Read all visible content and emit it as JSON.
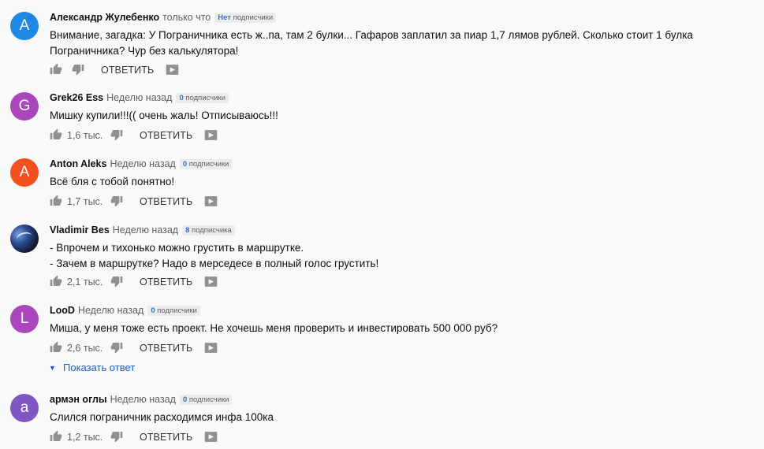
{
  "comments": [
    {
      "avatar_letter": "А",
      "avatar_color": "#1e88e5",
      "author": "Александр Жулебенко",
      "time": "только что",
      "badge_num": "Нет",
      "badge_label": "подписчики",
      "text": "Внимание, загадка: У Пограничника есть ж..па, там 2 булки... Гафаров заплатил за пиар 1,7 лямов рублей. Сколько стоит 1 булка Пограничника? Чур без калькулятора!",
      "likes": "",
      "reply_label": "ОТВЕТИТЬ"
    },
    {
      "avatar_letter": "G",
      "avatar_color": "#ab47bc",
      "author": "Grek26 Ess",
      "time": "Неделю назад",
      "badge_num": "0",
      "badge_label": "подписчики",
      "text": "Мишку купили!!!(( очень жаль! Отписываюсь!!!",
      "likes": "1,6 тыс.",
      "reply_label": "ОТВЕТИТЬ"
    },
    {
      "avatar_letter": "A",
      "avatar_color": "#f4511e",
      "author": "Anton Aleks",
      "time": "Неделю назад",
      "badge_num": "0",
      "badge_label": "подписчики",
      "text": "Всё бля с тобой понятно!",
      "likes": "1,7 тыс.",
      "reply_label": "ОТВЕТИТЬ"
    },
    {
      "avatar_letter": "",
      "avatar_color": "#1a2244",
      "author": "Vladimir Bes",
      "time": "Неделю назад",
      "badge_num": "8",
      "badge_label": "подписчика",
      "text_lines": [
        "- Впрочем и тихонько можно грустить в маршрутке.",
        "- Зачем в маршрутке? Надо в мерседесе в полный голос грустить!"
      ],
      "likes": "2,1 тыс.",
      "reply_label": "ОТВЕТИТЬ"
    },
    {
      "avatar_letter": "L",
      "avatar_color": "#ab47bc",
      "author": "LooD",
      "time": "Неделю назад",
      "badge_num": "0",
      "badge_label": "подписчики",
      "text": "Миша, у меня тоже есть проект. Не хочешь меня проверить и инвестировать 500 000 руб?",
      "likes": "2,6 тыс.",
      "reply_label": "ОТВЕТИТЬ",
      "show_replies": "Показать ответ"
    },
    {
      "avatar_letter": "а",
      "avatar_color": "#7e57c2",
      "author": "армэн оглы",
      "time": "Неделю назад",
      "badge_num": "0",
      "badge_label": "подписчики",
      "text": "Слился пограничник расходимся инфа 100ка",
      "likes": "1,2 тыс.",
      "reply_label": "ОТВЕТИТЬ"
    }
  ],
  "icons": {
    "like": "thumbs-up-icon",
    "dislike": "thumbs-down-icon",
    "share": "share-video-icon",
    "expand": "caret-down-icon"
  }
}
